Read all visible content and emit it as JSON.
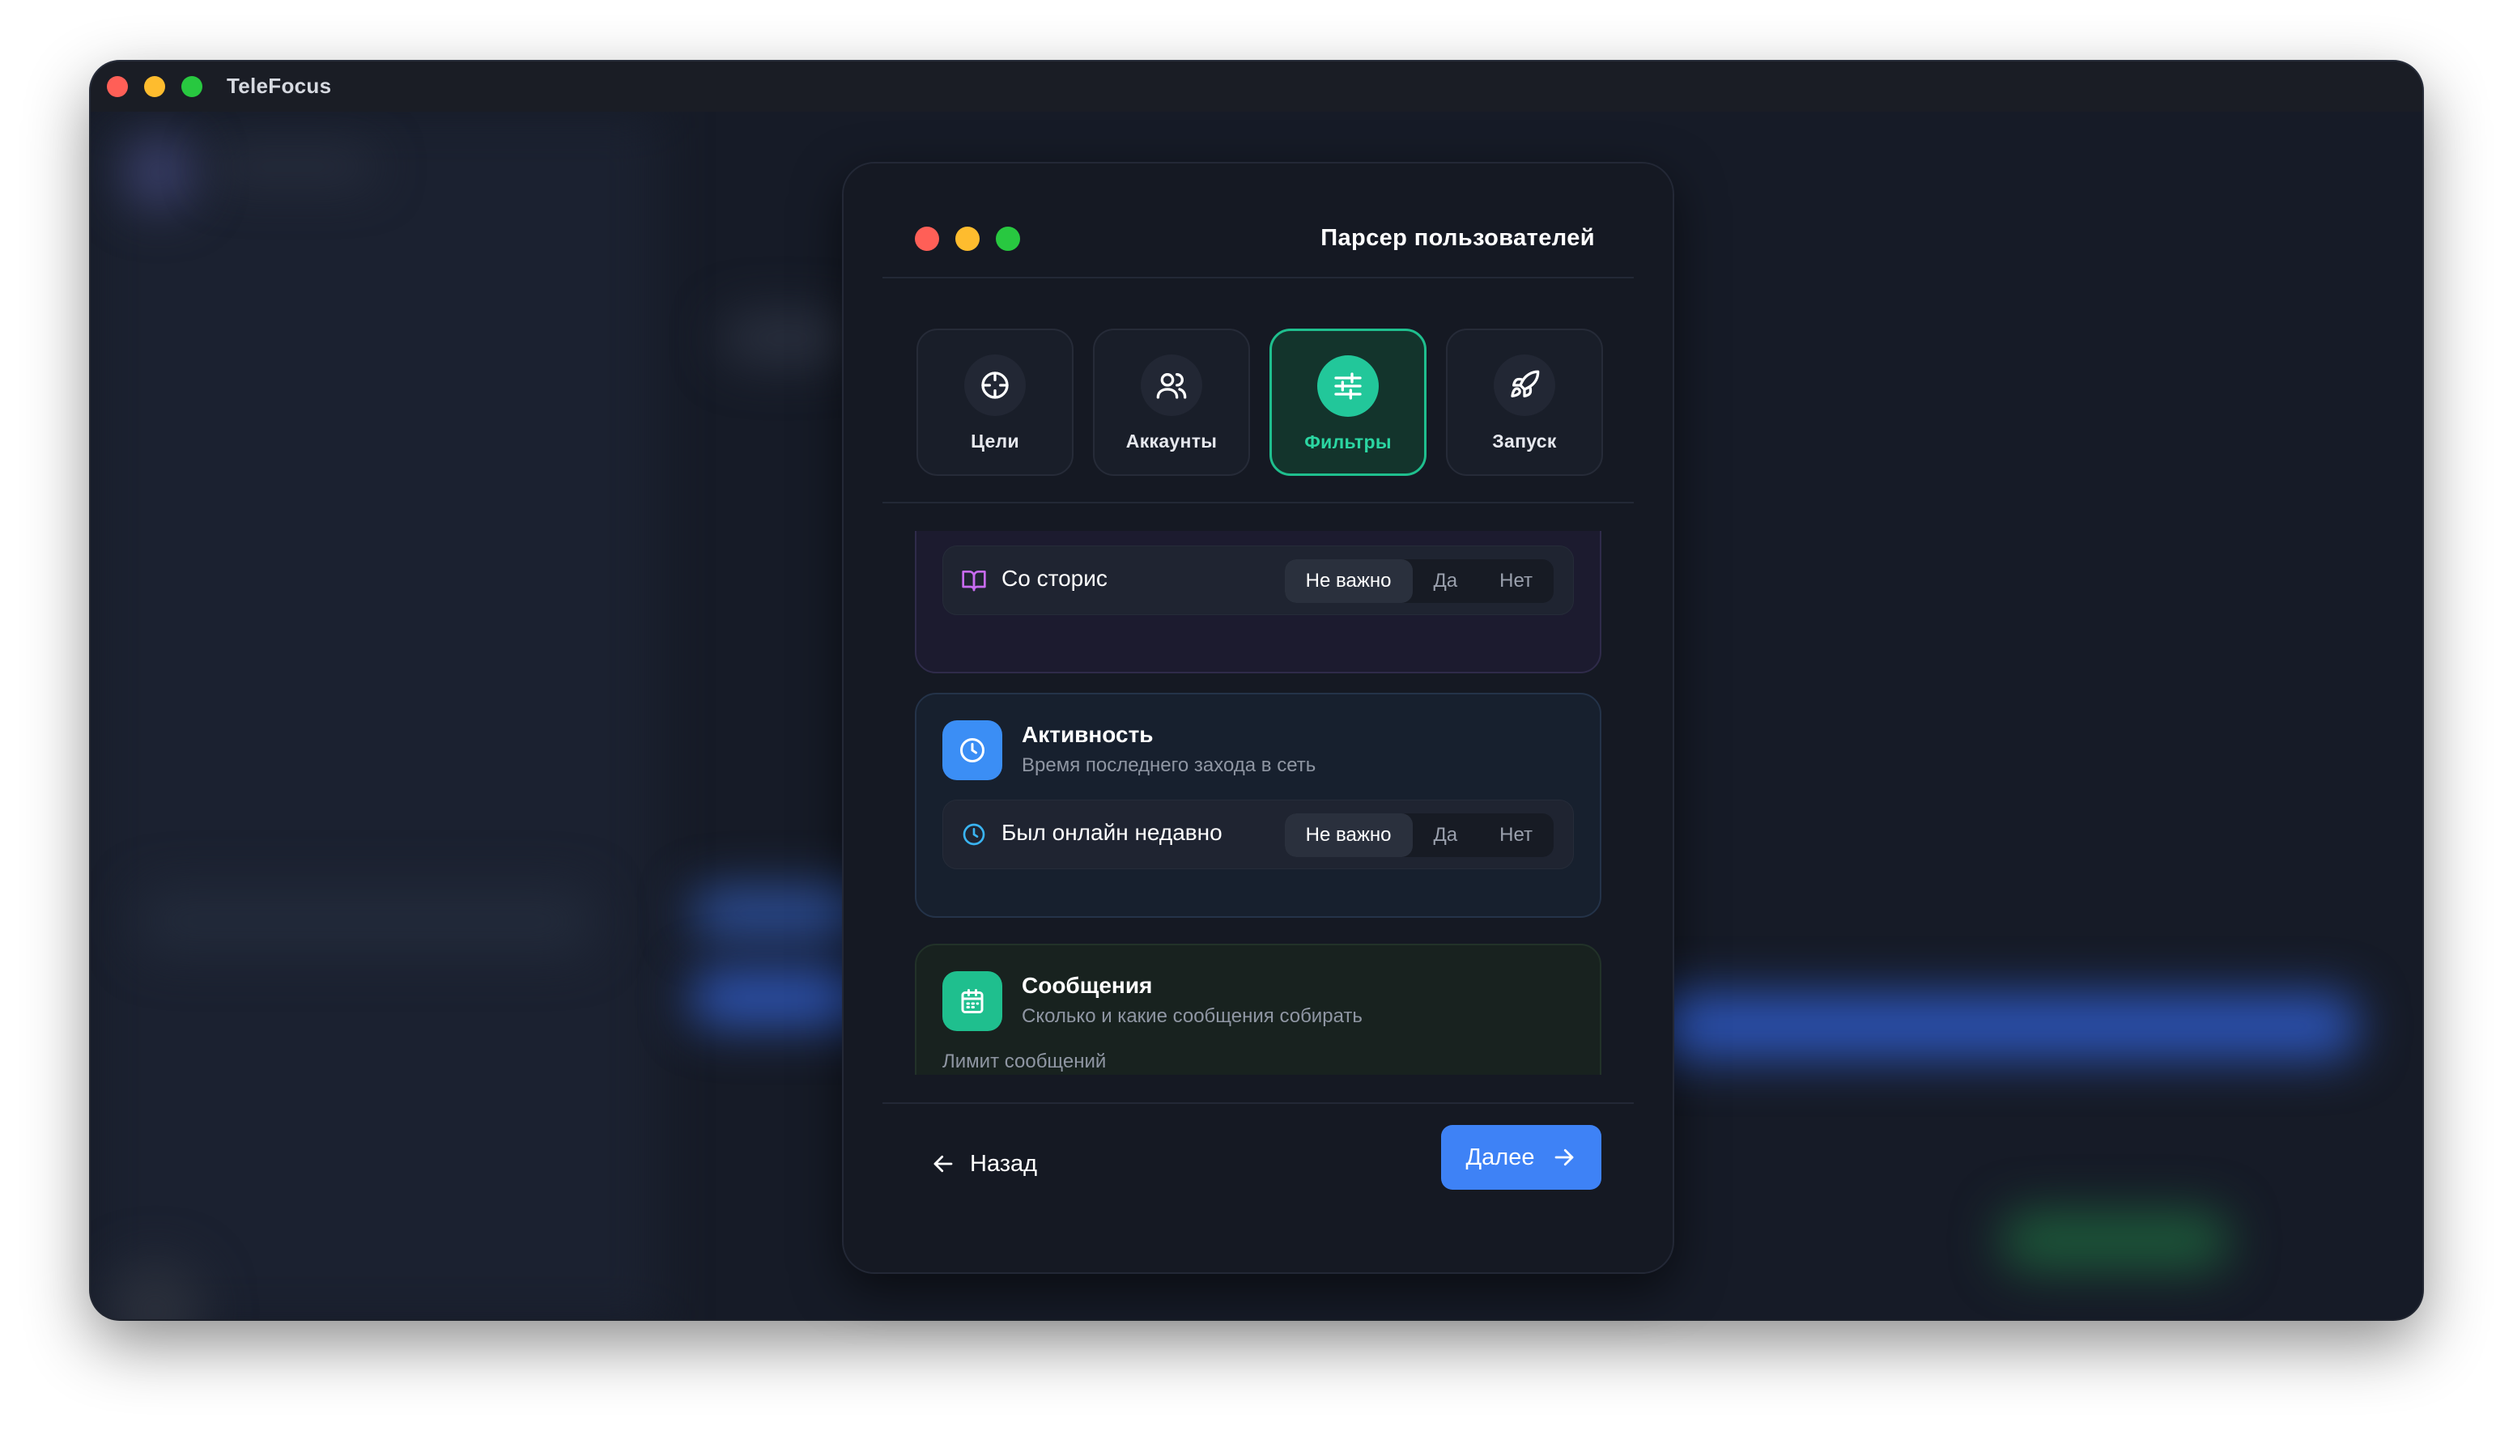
{
  "app": {
    "title": "TeleFocus",
    "traffic_lights": [
      "#ff5f57",
      "#febc2e",
      "#28c840"
    ]
  },
  "modal": {
    "title": "Парсер пользователей",
    "steps": [
      {
        "label": "Цели",
        "icon": "crosshair-icon",
        "active": false
      },
      {
        "label": "Аккаунты",
        "icon": "users-icon",
        "active": false
      },
      {
        "label": "Фильтры",
        "icon": "sliders-icon",
        "active": true
      },
      {
        "label": "Запуск",
        "icon": "rocket-icon",
        "active": false
      }
    ],
    "stories_filter": {
      "label": "Со сторис",
      "icon": "book-open-icon",
      "options": [
        "Не важно",
        "Да",
        "Нет"
      ],
      "selected": "Не важно"
    },
    "activity_section": {
      "title": "Активность",
      "subtitle": "Время последнего захода в сеть",
      "icon": "clock-icon",
      "filter": {
        "label": "Был онлайн недавно",
        "icon": "clock-icon",
        "options": [
          "Не важно",
          "Да",
          "Нет"
        ],
        "selected": "Не важно"
      }
    },
    "messages_section": {
      "title": "Сообщения",
      "subtitle": "Сколько и какие сообщения собирать",
      "icon": "calendar-icon",
      "limit_label": "Лимит сообщений"
    },
    "back_label": "Назад",
    "next_label": "Далее"
  },
  "colors": {
    "accent_green": "#22c79a",
    "accent_blue": "#3e82f6",
    "purple_icon": "#c86bf0"
  }
}
